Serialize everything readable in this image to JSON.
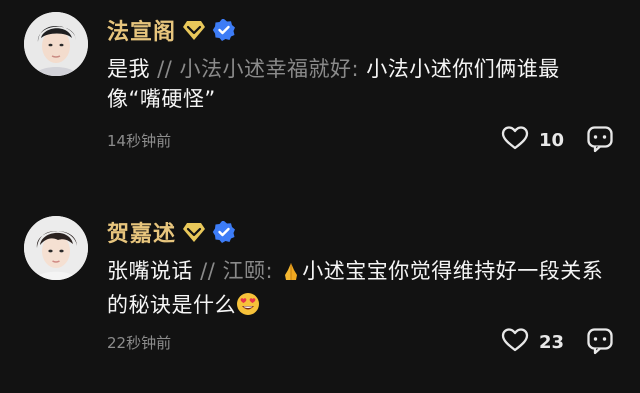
{
  "comments": [
    {
      "username": "法宣阁",
      "text_main": "是我",
      "quote_sep": " // ",
      "quote_author": "小法小述幸福就好:",
      "quote_text": " 小法小述你们俩谁最像“嘴硬怪”",
      "emoji_before": "",
      "emoji_after": "",
      "time": "14秒钟前",
      "likes": "10",
      "icons": [
        "diamond-badge-icon",
        "verified-check-icon",
        "heart-outline-icon",
        "comment-bubble-icon"
      ]
    },
    {
      "username": "贺嘉述",
      "text_main": "张嘴说话",
      "quote_sep": " // ",
      "quote_author": "江颐:",
      "quote_text": "小述宝宝你觉得维持好一段关系的秘诀是什么",
      "emoji_before": "folded-hands",
      "emoji_after": "heart-eyes",
      "time": "22秒钟前",
      "likes": "23",
      "icons": [
        "diamond-badge-icon",
        "verified-check-icon",
        "heart-outline-icon",
        "comment-bubble-icon"
      ]
    }
  ],
  "colors": {
    "background": "#121212",
    "username": "#e7c57d",
    "badge_gold": "#e9c85a",
    "verified_blue": "#3d7cf6",
    "muted": "#8a8a8a"
  }
}
